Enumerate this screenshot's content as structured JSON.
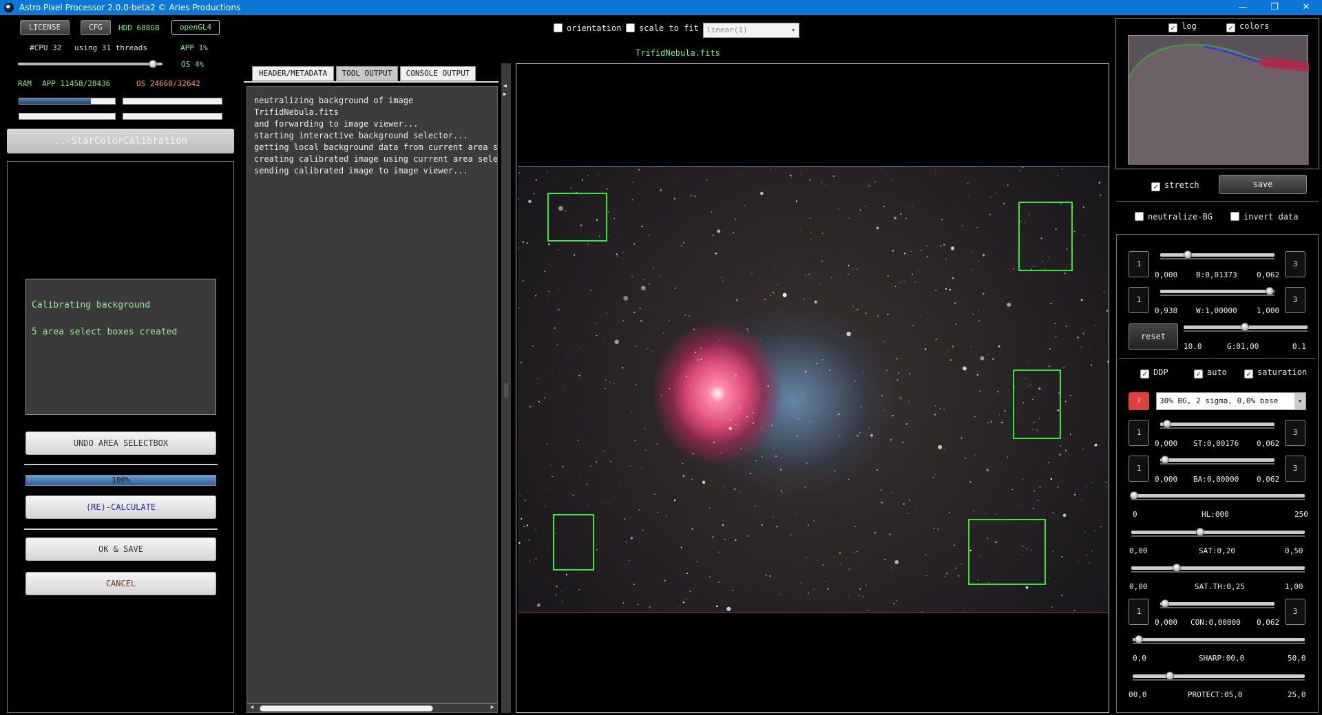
{
  "window": {
    "title": "Astro Pixel Processor 2.0.0-beta2 © Aries Productions",
    "minimize": "—",
    "restore": "❐",
    "close": "✕"
  },
  "top_buttons": {
    "license": "LICENSE",
    "cfg": "CFG",
    "hdd": "HDD 688GB",
    "opengl": "openGL4"
  },
  "system": {
    "cpu": "#CPU 32",
    "threads": "using 31 threads",
    "app_cpu": "APP 1%",
    "os_cpu": "OS 4%",
    "ram_label": "RAM",
    "ram_app": "APP 11458/28436",
    "ram_os": "OS 24660/32642",
    "thread_slider": 0.94,
    "ram_app_fraction": 0.75
  },
  "tool_button": "..-StarColorCalibration",
  "status": {
    "line1": "Calibrating background",
    "line2": "5 area select boxes created"
  },
  "actions": {
    "undo": "UNDO AREA SELECTBOX",
    "progress": "100%",
    "calculate": "(RE)-CALCULATE",
    "ok_save": "OK & SAVE",
    "cancel": "CANCEL"
  },
  "tabs": [
    "HEADER/METADATA",
    "TOOL OUTPUT",
    "CONSOLE OUTPUT"
  ],
  "console_lines": [
    "neutralizing background of image",
    "TrifidNebula.fits",
    "and forwarding to image viewer...",
    "starting interactive background selector...",
    "getting local background data from current area se",
    "creating calibrated image using current area select",
    "sending calibrated image to image viewer..."
  ],
  "viewer": {
    "orientation": "orientation",
    "scale_to_fit": "scale to fit",
    "stretch_mode": "linear(1)",
    "filename": "TrifidNebula.fits"
  },
  "histogram": {
    "log": "log",
    "colors": "colors",
    "log_checked": true,
    "colors_checked": true
  },
  "stretch": {
    "label": "stretch",
    "checked": true,
    "save": "save"
  },
  "neutralize_bg": "neutralize-BG",
  "invert_data": "invert data",
  "controls": {
    "b": {
      "min": "0,000",
      "label": "B:0,01373",
      "max": "0,062",
      "left": "1",
      "right": "3"
    },
    "w": {
      "min": "0,938",
      "label": "W:1,00000",
      "max": "1,000",
      "left": "1",
      "right": "3"
    },
    "g": {
      "reset": "reset",
      "min": "10.0",
      "label": "G:01,00",
      "max": "0.1"
    },
    "ddp": "DDP",
    "auto": "auto",
    "saturation": "saturation",
    "help": "?",
    "preset": "30% BG, 2 sigma, 0,0% base",
    "st": {
      "min": "0,000",
      "label": "ST:0,00176",
      "max": "0,062",
      "left": "1",
      "right": "3"
    },
    "ba": {
      "min": "0,000",
      "label": "BA:0,00000",
      "max": "0,062",
      "left": "1",
      "right": "3"
    },
    "hl": {
      "min": "0",
      "label": "HL:000",
      "max": "250"
    },
    "sat": {
      "min": "0,00",
      "label": "SAT:0,20",
      "max": "0,50"
    },
    "sat_th": {
      "min": "0,00",
      "label": "SAT.TH:0,25",
      "max": "1,00"
    },
    "con": {
      "min": "0,000",
      "label": "CON:0,00000",
      "max": "0,062",
      "left": "1",
      "right": "3"
    },
    "sharp": {
      "min": "0,0",
      "label": "SHARP:00,0",
      "max": "50,0"
    },
    "protect": {
      "min": "00,0",
      "label": "PROTECT:05,0",
      "max": "25,0"
    }
  },
  "colors": {
    "accent_green": "#7cf07c",
    "selection_box": "#2ff02f",
    "titlebar": "#0b78d7"
  }
}
